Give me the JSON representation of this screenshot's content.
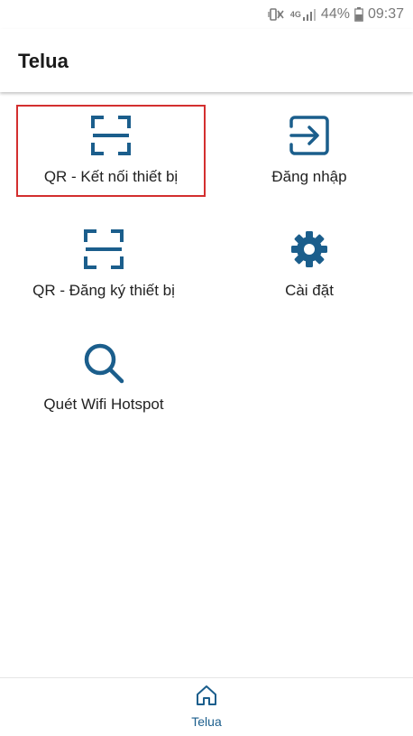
{
  "status_bar": {
    "network": "4G",
    "battery": "44%",
    "time": "09:37",
    "icons": [
      "mute-vibrate-icon",
      "signal-icon",
      "battery-icon"
    ]
  },
  "app_bar": {
    "title": "Telua"
  },
  "menu": {
    "items": [
      {
        "label": "QR - Kết nối thiết bị",
        "icon": "qr-scan-icon",
        "highlighted": true
      },
      {
        "label": "Đăng nhập",
        "icon": "login-icon"
      },
      {
        "label": "QR - Đăng ký thiết bị",
        "icon": "qr-scan-icon"
      },
      {
        "label": "Cài đặt",
        "icon": "gear-icon"
      },
      {
        "label": "Quét Wifi Hotspot",
        "icon": "search-icon"
      }
    ]
  },
  "bottom_nav": {
    "items": [
      {
        "label": "Telua",
        "icon": "home-icon",
        "active": true
      }
    ]
  },
  "colors": {
    "accent": "#1b5e8c",
    "highlight_border": "#d32f2f",
    "status_text": "#7a7a7a"
  }
}
